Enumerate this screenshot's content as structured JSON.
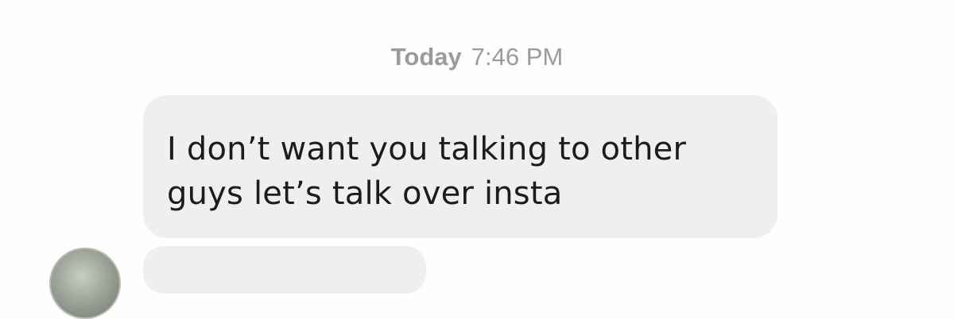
{
  "timestamp": {
    "day": "Today",
    "time": "7:46 PM"
  },
  "messages": [
    {
      "line1": "I don’t want you talking to other",
      "line2": "guys let’s talk over insta"
    }
  ],
  "colors": {
    "bubble_bg": "#efefef",
    "timestamp_text": "#9b9b9b",
    "message_text": "#1c1c1c"
  }
}
